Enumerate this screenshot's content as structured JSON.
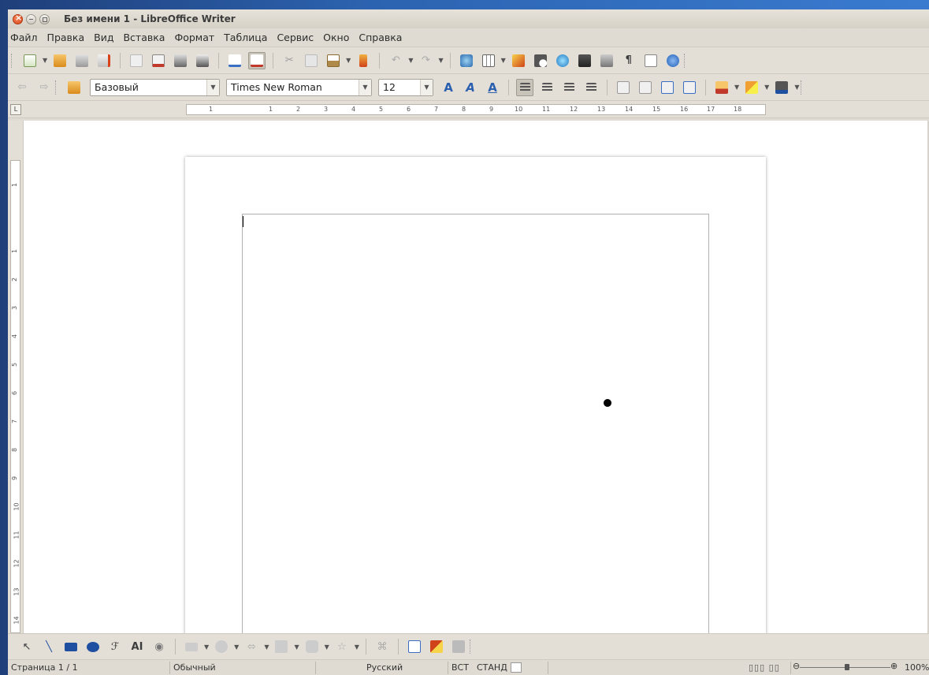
{
  "window": {
    "title": "Без имени 1 - LibreOffice Writer"
  },
  "menubar": {
    "items": [
      "Файл",
      "Правка",
      "Вид",
      "Вставка",
      "Формат",
      "Таблица",
      "Сервис",
      "Окно",
      "Справка"
    ]
  },
  "format_toolbar": {
    "style_value": "Базовый",
    "font_value": "Times New Roman",
    "size_value": "12"
  },
  "hruler": {
    "labels": [
      "1",
      "1",
      "2",
      "3",
      "4",
      "5",
      "6",
      "7",
      "8",
      "9",
      "10",
      "11",
      "12",
      "13",
      "14",
      "15",
      "16",
      "17",
      "18"
    ]
  },
  "vruler": {
    "labels": [
      "1",
      "1",
      "2",
      "3",
      "4",
      "5",
      "6",
      "7",
      "8",
      "9",
      "10",
      "11",
      "12",
      "13",
      "14"
    ]
  },
  "statusbar": {
    "page": "Страница 1 / 1",
    "style": "Обычный",
    "language": "Русский",
    "insert_mode": "ВСТ",
    "selection_mode": "СТАНД",
    "zoom": "100%"
  },
  "colors": {
    "desktop": "#2c63b0",
    "window_bg": "#dfdbd2",
    "close_button": "#d9431a"
  }
}
